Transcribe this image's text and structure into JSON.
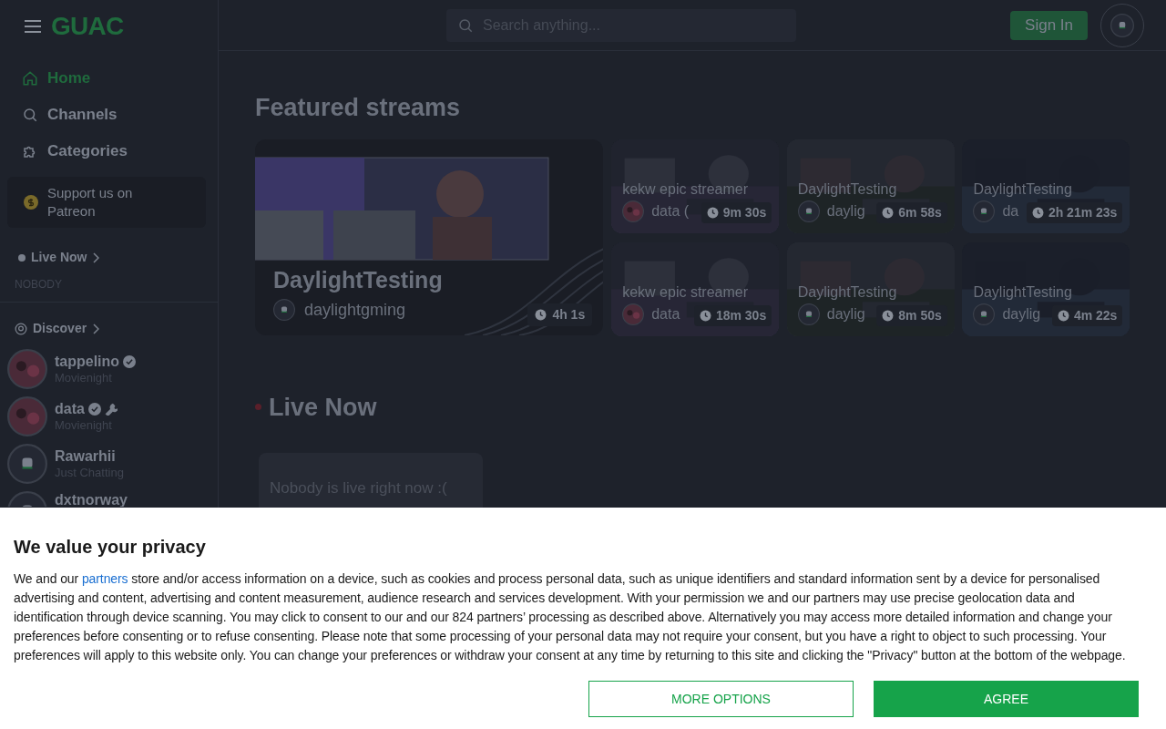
{
  "logo": "GUAC",
  "nav": [
    {
      "label": "Home",
      "selected": true
    },
    {
      "label": "Channels",
      "selected": false
    },
    {
      "label": "Categories",
      "selected": false
    }
  ],
  "patreon": "Support us on Patreon",
  "live_section": {
    "title": "Live Now",
    "empty": "NOBODY"
  },
  "discover": {
    "title": "Discover",
    "channels": [
      {
        "name": "tappelino",
        "category": "Movienight",
        "verified": true,
        "mod": false
      },
      {
        "name": "data",
        "category": "Movienight",
        "verified": true,
        "mod": true
      },
      {
        "name": "Rawarhii",
        "category": "Just Chatting",
        "verified": false,
        "mod": false,
        "kind": "default"
      },
      {
        "name": "dxtnorway",
        "verified": false,
        "mod": false,
        "kind": "default"
      }
    ]
  },
  "search": {
    "placeholder": "Search anything..."
  },
  "sign_in": "Sign In",
  "featured": {
    "title": "Featured streams",
    "main": {
      "title": "DaylightTesting",
      "streamer": "daylightgming",
      "duration": "4h 1s"
    },
    "cards": [
      {
        "title": "kekw epic streamer",
        "streamer": "data (",
        "duration": "9m 30s"
      },
      {
        "title": "DaylightTesting",
        "streamer": "daylig",
        "duration": "6m 58s",
        "kind": "default"
      },
      {
        "title": "DaylightTesting",
        "streamer": "da",
        "duration": "2h 21m 23s",
        "kind": "default"
      },
      {
        "title": "kekw epic streamer",
        "streamer": "data",
        "duration": "18m 30s"
      },
      {
        "title": "DaylightTesting",
        "streamer": "daylig",
        "duration": "8m 50s",
        "kind": "default"
      },
      {
        "title": "DaylightTesting",
        "streamer": "daylig",
        "duration": "4m 22s",
        "kind": "default"
      }
    ]
  },
  "live_now": {
    "title": "Live Now",
    "empty": "Nobody is live right now :("
  },
  "consent": {
    "title": "We value your privacy",
    "text_start": "We and our",
    "link": "partners",
    "text_end": "store and/or access information on a device, such as cookies and process personal data, such as unique identifiers and standard information sent by a device for personalised advertising and content, advertising and content measurement, audience research and services development. With your permission we and our partners may use precise geolocation data and identification through device scanning. You may click to consent to our and our 824 partners’ processing as described above. Alternatively you may access more detailed information and change your preferences before consenting or to refuse consenting. Please note that some processing of your personal data may not require your consent, but you have a right to object to such processing. Your preferences will apply to this website only. You can change your preferences or withdraw your consent at any time by returning to this site and clicking the \"Privacy\" button at the bottom of the webpage.",
    "buttons": [
      {
        "label": "MORE OPTIONS",
        "kind": "outline"
      },
      {
        "label": "AGREE",
        "kind": "solid"
      }
    ]
  }
}
